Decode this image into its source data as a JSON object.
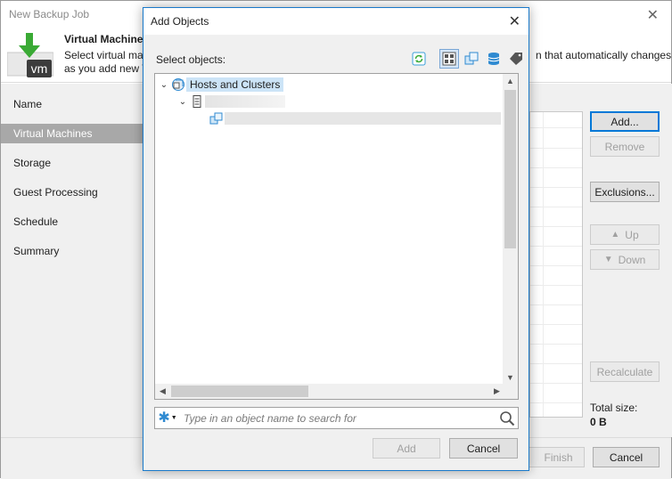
{
  "main_window": {
    "title": "New Backup Job",
    "header_title": "Virtual Machines",
    "header_desc_line1": "Select virtual ma",
    "header_desc_line2": "as you add new V",
    "header_desc_right": "n that automatically changes",
    "logo_text": "vm",
    "steps": [
      {
        "label": "Name",
        "active": false
      },
      {
        "label": "Virtual Machines",
        "active": true
      },
      {
        "label": "Storage",
        "active": false
      },
      {
        "label": "Guest Processing",
        "active": false
      },
      {
        "label": "Schedule",
        "active": false
      },
      {
        "label": "Summary",
        "active": false
      }
    ],
    "buttons": {
      "add": "Add...",
      "remove": "Remove",
      "exclusions": "Exclusions...",
      "up": "Up",
      "down": "Down",
      "recalculate": "Recalculate",
      "finish": "Finish",
      "cancel": "Cancel"
    },
    "total_size_label": "Total size:",
    "total_size_value": "0 B"
  },
  "dialog": {
    "title": "Add Objects",
    "select_label": "Select objects:",
    "view_buttons": [
      "refresh-icon",
      "hosts-clusters-view-icon",
      "vms-templates-view-icon",
      "datastores-view-icon",
      "tags-view-icon"
    ],
    "tree": {
      "root_label": "Hosts and Clusters",
      "host_label": "",
      "cluster_label": ""
    },
    "search": {
      "placeholder": "Type in an object name to search for",
      "value": ""
    },
    "buttons": {
      "add": "Add",
      "cancel": "Cancel"
    }
  },
  "colors": {
    "accent": "#0078d7",
    "selection": "#cce4f7",
    "sidebar_active": "#a8a8a8",
    "logo_green": "#3aaa35",
    "logo_dark": "#3c3c3c"
  }
}
